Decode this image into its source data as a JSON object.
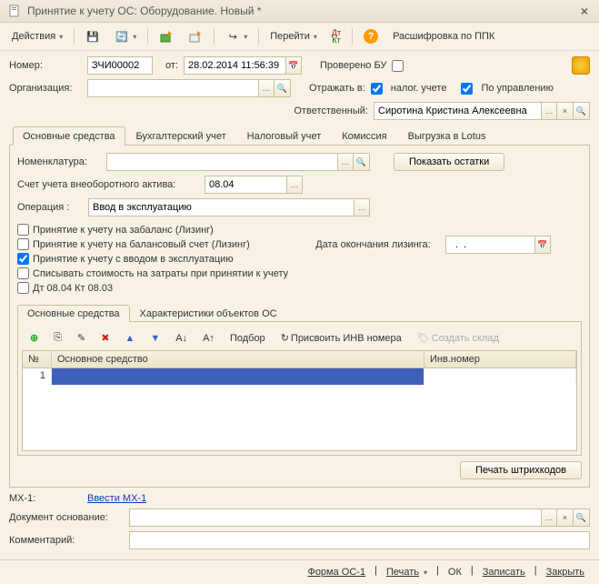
{
  "window": {
    "title": "Принятие к учету ОС: Оборудование. Новый *"
  },
  "toolbar": {
    "actions": "Действия",
    "goto": "Перейти",
    "decode": "Расшифровка по ППК"
  },
  "header": {
    "number_label": "Номер:",
    "number_value": "ЗЧИ00002",
    "from_label": "от:",
    "date_value": "28.02.2014 11:56:39",
    "verified_label": "Проверено БУ",
    "org_label": "Организация:",
    "org_value": "",
    "reflect_label": "Отражать в:",
    "tax_chk": "налог. учете",
    "mgmt_chk": "По управлению",
    "responsible_label": "Ответственный:",
    "responsible_value": "Сиротина Кристина Алексеевна"
  },
  "tabs_main": {
    "t1": "Основные средства",
    "t2": "Бухгалтерский учет",
    "t3": "Налоговый учет",
    "t4": "Комиссия",
    "t5": "Выгрузка в Lotus"
  },
  "panel": {
    "nomen_label": "Номенклатура:",
    "nomen_value": "",
    "show_balances": "Показать остатки",
    "account_label": "Счет учета внеоборотного актива:",
    "account_value": "08.04",
    "operation_label": "Операция :",
    "operation_value": "Ввод в эксплуатацию",
    "chk1": "Принятие к учету на забаланс (Лизинг)",
    "chk2": "Принятие к учету на балансовый счет (Лизинг)",
    "chk3": "Принятие к учету с вводом в эксплуатацию",
    "chk4": "Списывать стоимость на затраты при принятии к учету",
    "chk5": "Дт 08.04 Кт 08.03",
    "leasing_end_label": "Дата окончания лизинга:",
    "leasing_end_value": "  .  .    "
  },
  "subtabs": {
    "s1": "Основные средства",
    "s2": "Характеристики объектов ОС"
  },
  "grid_toolbar": {
    "pick": "Подбор",
    "assign": "Присвоить ИНВ номера",
    "create_wh": "Создать склад"
  },
  "grid": {
    "col_num": "№",
    "col_asset": "Основное средство",
    "col_inv": "Инв.номер",
    "rows": [
      {
        "n": "1",
        "asset": "",
        "inv": ""
      }
    ]
  },
  "print_barcodes": "Печать штрихкодов",
  "mx1_label": "МХ-1:",
  "mx1_link": "Ввести МХ-1",
  "doc_basis_label": "Документ основание:",
  "doc_basis_value": "",
  "comment_label": "Комментарий:",
  "comment_value": "",
  "footer": {
    "form": "Форма ОС-1",
    "print": "Печать",
    "ok": "ОК",
    "save": "Записать",
    "close": "Закрыть"
  }
}
